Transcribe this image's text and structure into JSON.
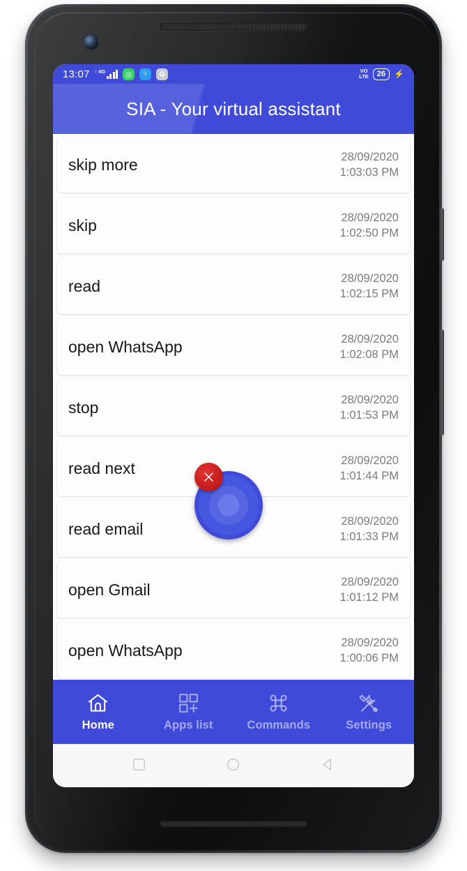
{
  "device": {
    "earpiece": "earpiece-speaker",
    "front_camera": "front-camera",
    "bottom_speaker": "bottom-speaker",
    "power_button": "power-button",
    "volume_rocker": "volume-rocker"
  },
  "status_bar": {
    "clock": "13:07",
    "network_label": "4G",
    "uplink_glyph": "↑",
    "icons": [
      {
        "name": "whatsapp-icon",
        "glyph": "◎",
        "color": "#38d06a"
      },
      {
        "name": "usb-icon",
        "glyph": "⑂",
        "color": "#2e9df0"
      },
      {
        "name": "sync-icon",
        "glyph": "♻",
        "color": "#c9ccd1"
      }
    ],
    "volte_line1": "VO",
    "volte_line2": "LTE",
    "battery_level": "26",
    "charging_glyph": "⚡"
  },
  "header": {
    "title": "SIA - Your virtual assistant",
    "background": "#3f4bd8"
  },
  "list": {
    "items": [
      {
        "command": "skip more",
        "date": "28/09/2020",
        "time": "1:03:03 PM"
      },
      {
        "command": "skip",
        "date": "28/09/2020",
        "time": "1:02:50 PM"
      },
      {
        "command": "read",
        "date": "28/09/2020",
        "time": "1:02:15 PM"
      },
      {
        "command": "open WhatsApp",
        "date": "28/09/2020",
        "time": "1:02:08 PM"
      },
      {
        "command": "stop",
        "date": "28/09/2020",
        "time": "1:01:53 PM"
      },
      {
        "command": "read next",
        "date": "28/09/2020",
        "time": "1:01:44 PM"
      },
      {
        "command": "read email",
        "date": "28/09/2020",
        "time": "1:01:33 PM"
      },
      {
        "command": "open Gmail",
        "date": "28/09/2020",
        "time": "1:01:12 PM"
      },
      {
        "command": "open WhatsApp",
        "date": "28/09/2020",
        "time": "1:00:06 PM"
      }
    ]
  },
  "assistant_bubble": {
    "orb_name": "assistant-orb",
    "orb_color": "#3f4bd8",
    "close_name": "close-bubble-button",
    "close_color": "#c81d1d"
  },
  "bottom_nav": {
    "items": [
      {
        "label": "Home",
        "icon": "home-icon",
        "active": true
      },
      {
        "label": "Apps list",
        "icon": "apps-add-icon",
        "active": false
      },
      {
        "label": "Commands",
        "icon": "command-icon",
        "active": false
      },
      {
        "label": "Settings",
        "icon": "tools-icon",
        "active": false
      }
    ]
  },
  "system_nav": {
    "recents": "recents-square-icon",
    "home": "home-circle-icon",
    "back": "back-triangle-icon"
  }
}
